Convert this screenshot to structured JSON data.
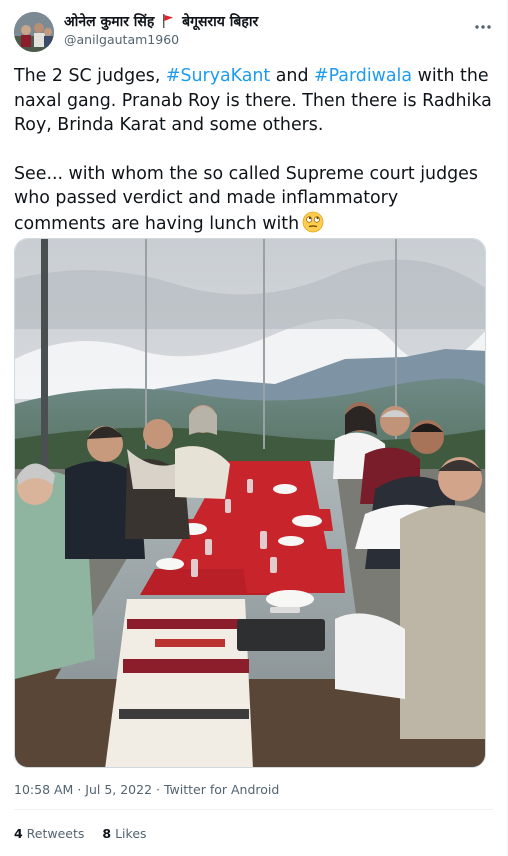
{
  "author": {
    "display_name_part1": "ओनेल कुमार सिंह",
    "display_name_part2": "बेगूसराय बिहार",
    "handle": "@anilgautam1960",
    "flag_icon": "red-triangular-flag-icon",
    "avatar_icon": "avatar"
  },
  "tweet": {
    "p1_a": "The 2 SC judges, ",
    "hashtag1": "#SuryaKant",
    "p1_b": " and ",
    "hashtag2": "#Pardiwala",
    "p1_c": " with the naxal gang.  Pranab Roy is there. Then there is Radhika Roy, Brinda Karat and some others.",
    "p2": "See... with whom the so called Supreme court judges who passed verdict and made inflammatory comments are having lunch with",
    "emoji_icon": "face-with-rolling-eyes-icon",
    "more_icon": "more-options-icon"
  },
  "meta": {
    "time": "10:58 AM",
    "sep1": " · ",
    "date": "Jul 5, 2022",
    "sep2": " · ",
    "source": "Twitter for Android"
  },
  "stats": {
    "retweets_count": "4",
    "retweets_label": " Retweets",
    "likes_count": "8",
    "likes_label": " Likes"
  },
  "colors": {
    "hashtag": "#1d9bf0",
    "secondary_text": "#536471",
    "primary_text": "#0f1419",
    "tablecloth_red": "#c8242b"
  }
}
